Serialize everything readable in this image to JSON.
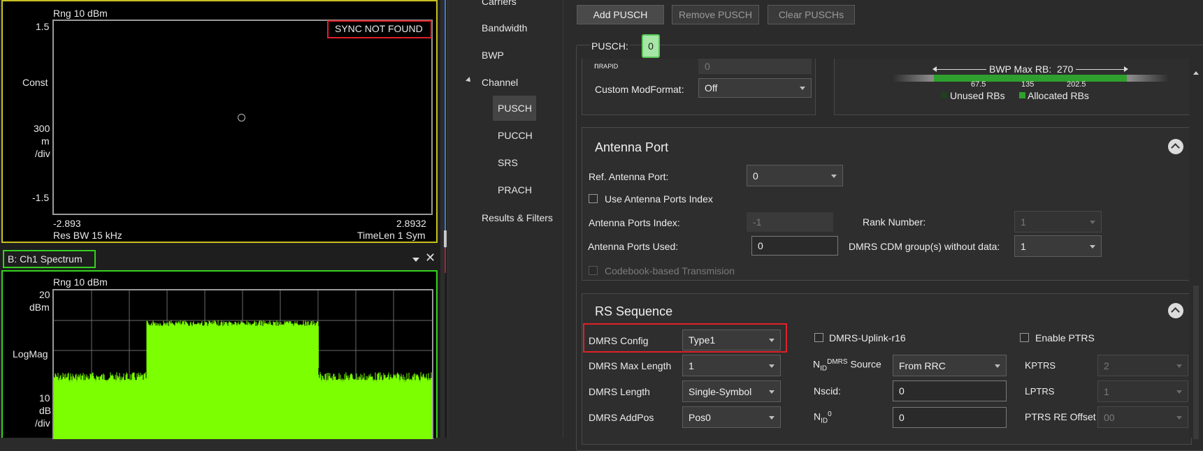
{
  "const_panel": {
    "range": "Rng 10 dBm",
    "y_top": "1.5",
    "y_label": "Const",
    "y_div_value": "300",
    "y_div_unit": "m",
    "y_div_per": "/div",
    "y_bottom": "-1.5",
    "x_left": "-2.893",
    "x_right": "2.8932",
    "res_bw": "Res BW 15 kHz",
    "time_len": "TimeLen 1  Sym",
    "sync_status": "SYNC NOT FOUND"
  },
  "spectrum_panel": {
    "title": "B: Ch1 Spectrum",
    "range": "Rng 10 dBm",
    "y_top_value": "20",
    "y_top_unit": "dBm",
    "y_label": "LogMag",
    "y_div_value": "10",
    "y_div_unit": "dB",
    "y_div_per": "/div",
    "trace_color": "#7cff00"
  },
  "nav": {
    "items": [
      "Carriers",
      "Bandwidth",
      "BWP",
      "Channel",
      "PUSCH",
      "PUCCH",
      "SRS",
      "PRACH",
      "Results & Filters"
    ],
    "selected": "PUSCH"
  },
  "toolbar": {
    "add": "Add PUSCH",
    "remove": "Remove PUSCH",
    "clear": "Clear PUSCHs"
  },
  "pusch": {
    "label": "PUSCH:",
    "index": "0",
    "n_rapid_label": "n",
    "n_rapid_sub": "RAPID",
    "n_rapid_value": "0",
    "custom_modformat_label": "Custom ModFormat:",
    "custom_modformat_value": "Off",
    "bwp_max_rb_label": "BWP Max RB:",
    "bwp_max_rb_value": "270",
    "rb_ticks": [
      "67.5",
      "135",
      "202.5"
    ],
    "legend_unused": "Unused RBs",
    "legend_allocated": "Allocated RBs",
    "allocated_color": "#2ea02e",
    "unused_color": "#1f3f1f",
    "allocated_fraction": 1.0
  },
  "antenna_port": {
    "title": "Antenna Port",
    "ref_port_label": "Ref. Antenna Port:",
    "ref_port_value": "0",
    "use_index_label": "Use Antenna Ports Index",
    "ports_index_label": "Antenna Ports Index:",
    "ports_index_value": "-1",
    "rank_label": "Rank Number:",
    "rank_value": "1",
    "ports_used_label": "Antenna Ports Used:",
    "ports_used_value": "0",
    "cdm_label": "DMRS CDM group(s) without data:",
    "cdm_value": "1",
    "codebook_label": "Codebook-based Transmision"
  },
  "rs_sequence": {
    "title": "RS Sequence",
    "dmrs_config_label": "DMRS Config",
    "dmrs_config_value": "Type1",
    "dmrs_max_length_label": "DMRS Max Length",
    "dmrs_max_length_value": "1",
    "dmrs_length_label": "DMRS Length",
    "dmrs_length_value": "Single-Symbol",
    "dmrs_addpos_label": "DMRS AddPos",
    "dmrs_addpos_value": "Pos0",
    "uplink_r16_label": "DMRS-Uplink-r16",
    "nid_source_n": "N",
    "nid_source_sub": "ID",
    "nid_source_sup": "DMRS",
    "nid_source_label": "Source",
    "nid_source_value": "From RRC",
    "nscid_label": "Nscid:",
    "nscid_value": "0",
    "nid0_n": "N",
    "nid0_sub": "ID",
    "nid0_sup": "0",
    "nid0_value": "0",
    "enable_ptrs_label": "Enable PTRS",
    "kptrs_k": "K",
    "kptrs_label": "PTRS",
    "kptrs_value": "2",
    "lptrs_l": "L",
    "lptrs_label": "PTRS",
    "lptrs_value": "1",
    "ptrs_re_offset_label": "PTRS RE Offset",
    "ptrs_re_offset_value": "00"
  }
}
